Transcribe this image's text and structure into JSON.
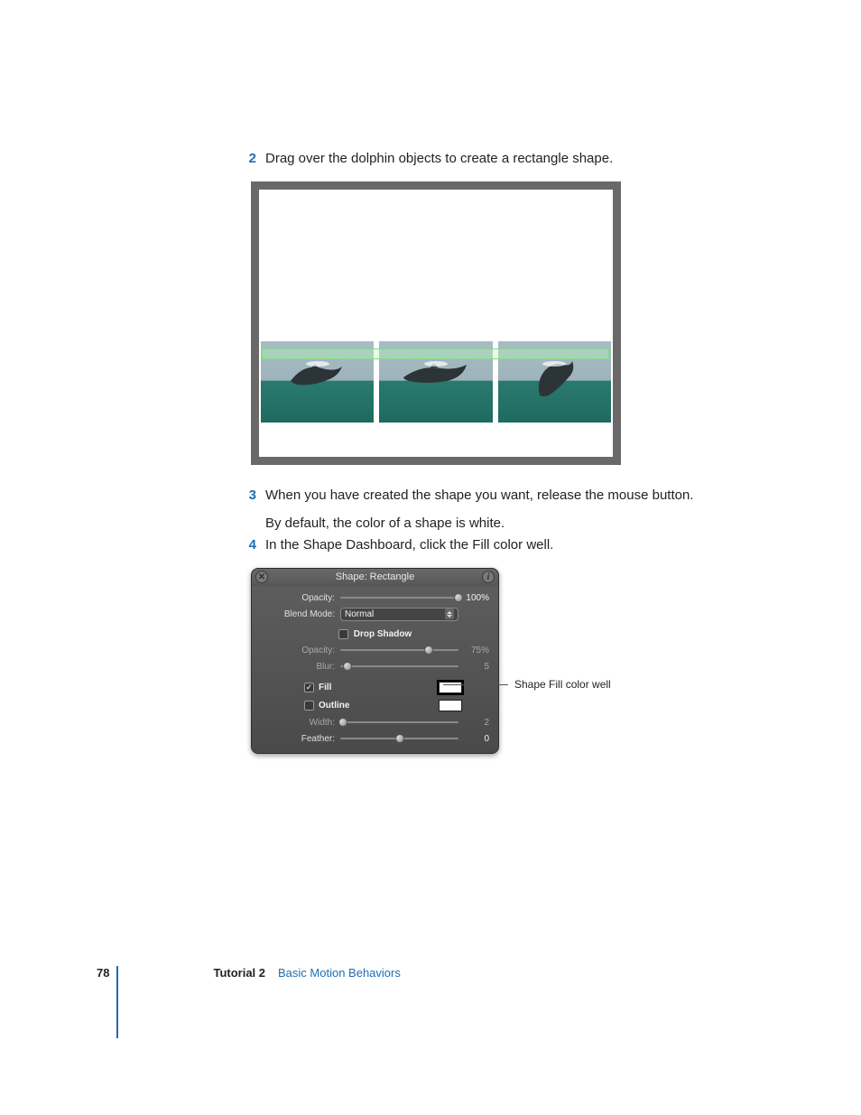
{
  "steps": {
    "s2": {
      "num": "2",
      "text": "Drag over the dolphin objects to create a rectangle shape."
    },
    "s3": {
      "num": "3",
      "text1": "When you have created the shape you want, release the mouse button.",
      "text2": "By default, the color of a shape is white."
    },
    "s4": {
      "num": "4",
      "text": "In the Shape Dashboard, click the Fill color well."
    }
  },
  "hud": {
    "title": "Shape: Rectangle",
    "close_glyph": "✕",
    "info_glyph": "i",
    "opacity": {
      "label": "Opacity:",
      "value": "100%"
    },
    "blend_mode": {
      "label": "Blend Mode:",
      "value": "Normal"
    },
    "drop_shadow": {
      "label": "Drop Shadow",
      "checked": false
    },
    "ds_opacity": {
      "label": "Opacity:",
      "value": "75%"
    },
    "ds_blur": {
      "label": "Blur:",
      "value": "5"
    },
    "fill": {
      "label": "Fill",
      "checked": true
    },
    "outline": {
      "label": "Outline",
      "checked": false
    },
    "width": {
      "label": "Width:",
      "value": "2"
    },
    "feather": {
      "label": "Feather:",
      "value": "0"
    }
  },
  "callout": "Shape Fill color well",
  "footer": {
    "page": "78",
    "tutorial_label": "Tutorial 2",
    "tutorial_title": "Basic Motion Behaviors"
  }
}
